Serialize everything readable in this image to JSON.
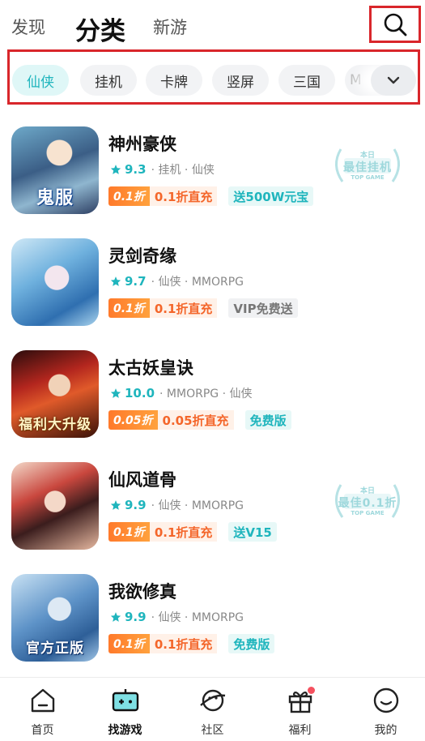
{
  "top_tabs": [
    {
      "label": "发现"
    },
    {
      "label": "分类",
      "active": true
    },
    {
      "label": "新游"
    }
  ],
  "chips": [
    {
      "label": "仙侠",
      "active": true
    },
    {
      "label": "挂机"
    },
    {
      "label": "卡牌"
    },
    {
      "label": "竖屏"
    },
    {
      "label": "三国"
    },
    {
      "label": "M"
    }
  ],
  "games": [
    {
      "name": "神州豪侠",
      "score": "9.3",
      "tags": "· 挂机 · 仙侠",
      "discount_badge": "0.1折",
      "discount_text": "0.1折直充",
      "perk": "送500W元宝",
      "perk_style": "teal",
      "cover_caption": "鬼服",
      "award": {
        "line1": "本日",
        "line2": "最佳挂机",
        "line3": "TOP GAME"
      }
    },
    {
      "name": "灵剑奇缘",
      "score": "9.7",
      "tags": "· 仙侠 · MMORPG",
      "discount_badge": "0.1折",
      "discount_text": "0.1折直充",
      "perk": "VIP免费送",
      "perk_style": "gray",
      "cover_caption": ""
    },
    {
      "name": "太古妖皇诀",
      "score": "10.0",
      "tags": "· MMORPG · 仙侠",
      "discount_badge": "0.05折",
      "discount_text": "0.05折直充",
      "perk": "免费版",
      "perk_style": "teal",
      "cover_caption": "福利大升级"
    },
    {
      "name": "仙风道骨",
      "score": "9.9",
      "tags": "· 仙侠 · MMORPG",
      "discount_badge": "0.1折",
      "discount_text": "0.1折直充",
      "perk": "送V15",
      "perk_style": "teal",
      "cover_caption": "",
      "award": {
        "line1": "本日",
        "line2": "最佳0.1折",
        "line3": "TOP GAME"
      }
    },
    {
      "name": "我欲修真",
      "score": "9.9",
      "tags": "· 仙侠 · MMORPG",
      "discount_badge": "0.1折",
      "discount_text": "0.1折直充",
      "perk": "免费版",
      "perk_style": "teal",
      "cover_caption": "官方正版"
    }
  ],
  "bottom_nav": [
    {
      "label": "首页",
      "icon": "home-icon"
    },
    {
      "label": "找游戏",
      "icon": "gamepad-icon",
      "active": true
    },
    {
      "label": "社区",
      "icon": "planet-icon"
    },
    {
      "label": "福利",
      "icon": "gift-icon",
      "badge_dot": true
    },
    {
      "label": "我的",
      "icon": "smile-icon"
    }
  ],
  "colors": {
    "accent": "#1fb5bd",
    "highlight_border": "#d9262b",
    "discount_orange": "#ff8a33",
    "badge_dot": "#f5515f"
  }
}
